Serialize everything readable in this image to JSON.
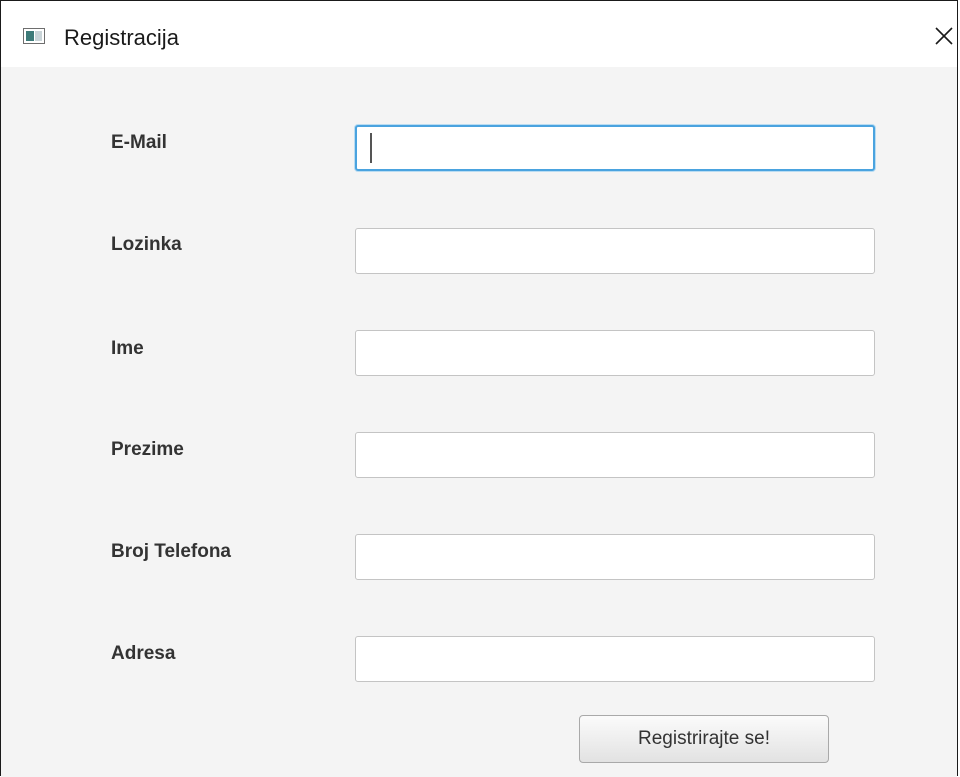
{
  "window": {
    "title": "Registracija",
    "icons": {
      "app": "app-window-icon",
      "close": "close-icon"
    }
  },
  "form": {
    "fields": [
      {
        "label": "E-Mail",
        "value": "",
        "focused": true
      },
      {
        "label": "Lozinka",
        "value": ""
      },
      {
        "label": "Ime",
        "value": ""
      },
      {
        "label": "Prezime",
        "value": ""
      },
      {
        "label": "Broj Telefona",
        "value": ""
      },
      {
        "label": "Adresa",
        "value": ""
      }
    ],
    "submit_label": "Registrirajte se!"
  },
  "colors": {
    "focus_border": "#4aa3df",
    "background": "#f4f4f4"
  }
}
